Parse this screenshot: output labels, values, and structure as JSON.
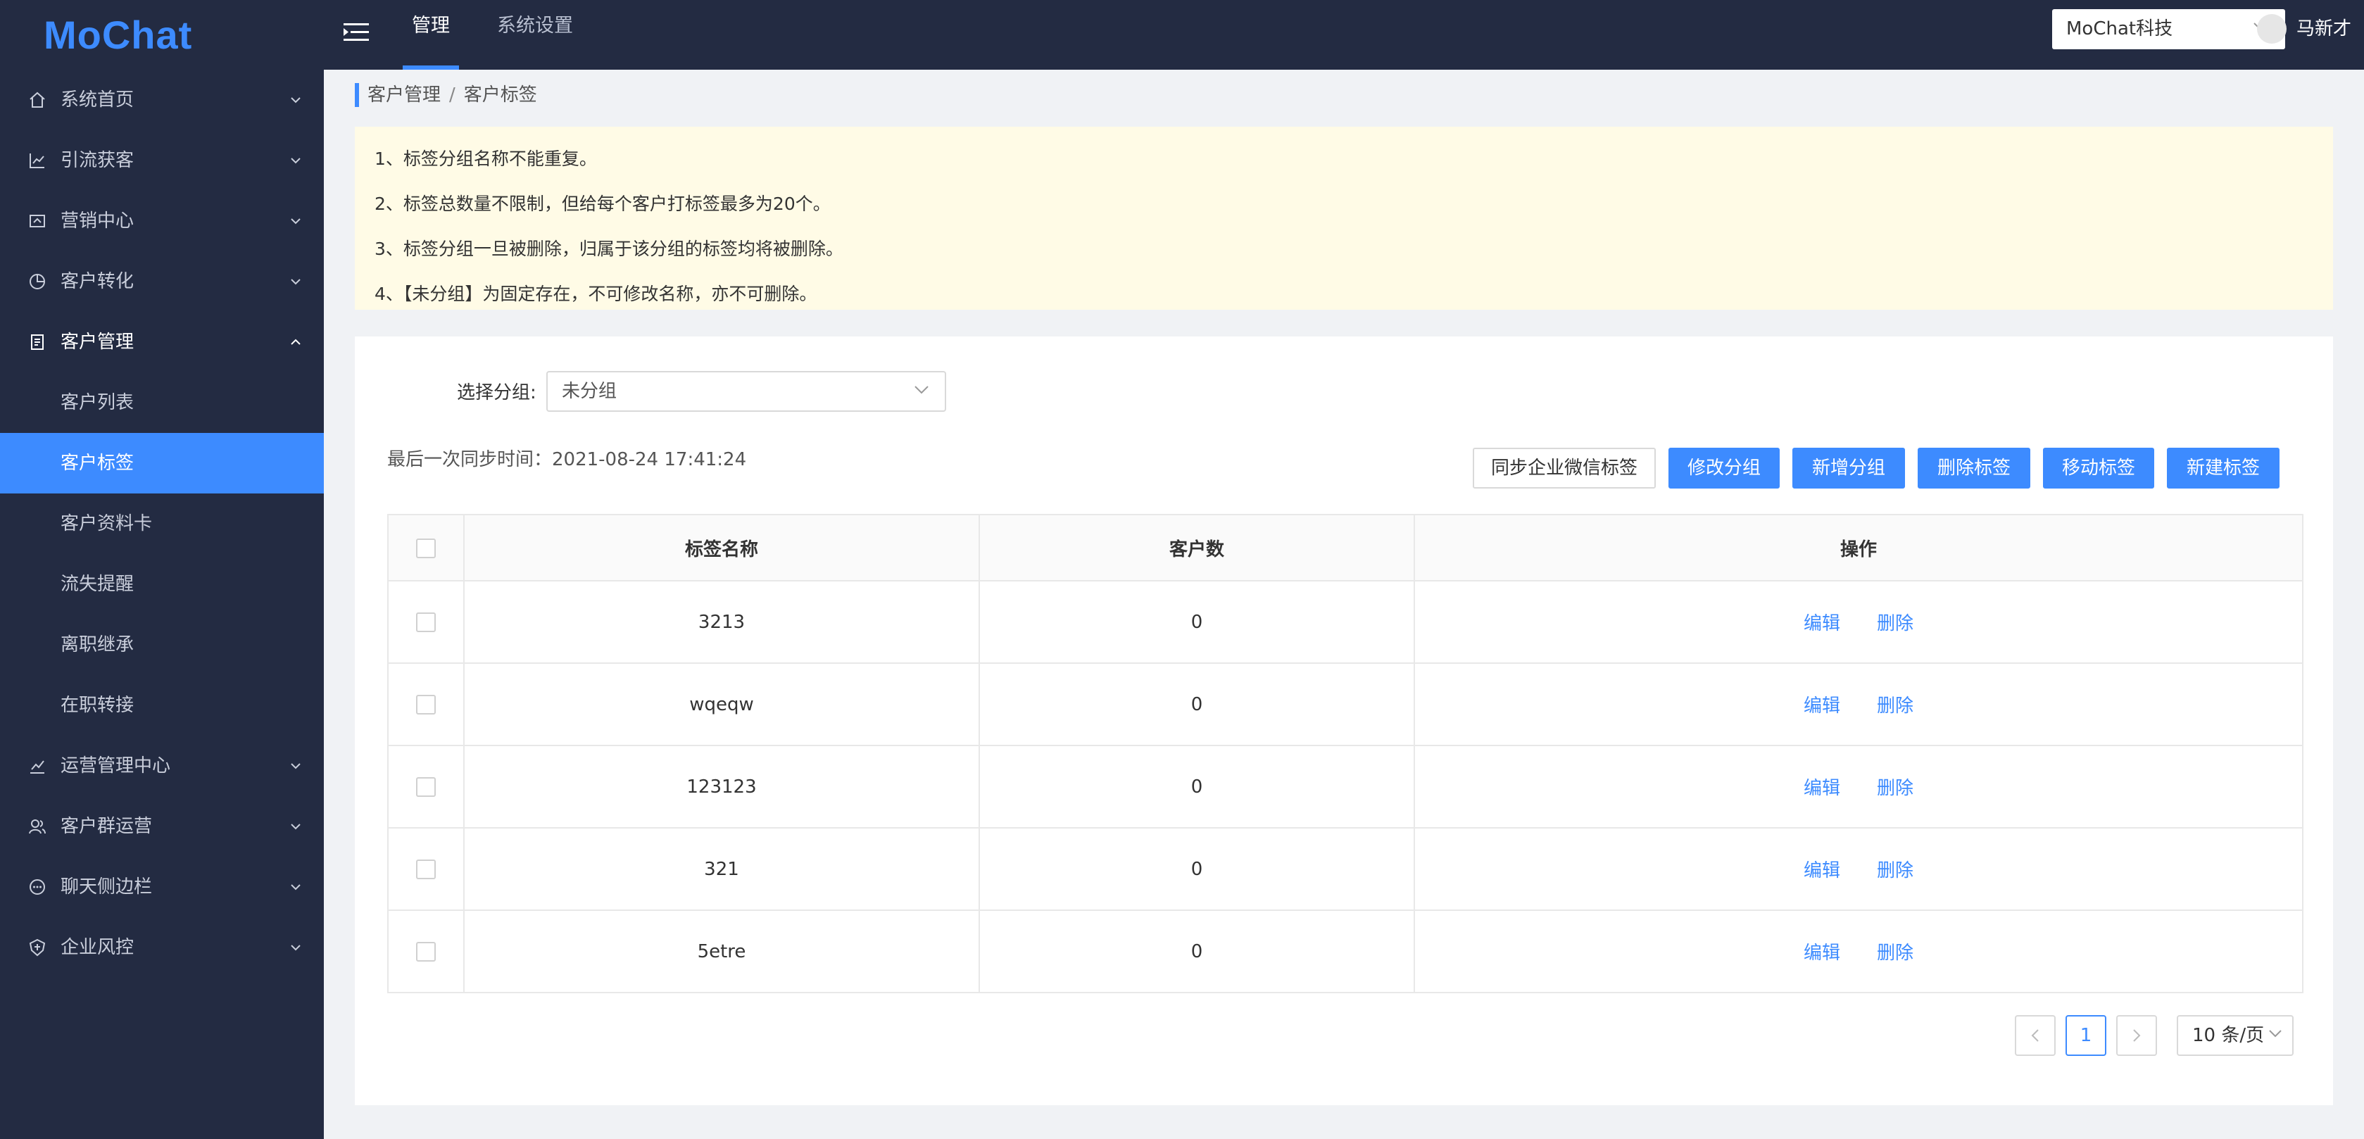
{
  "app": {
    "logo": "MoChat"
  },
  "topbar": {
    "tabs": [
      {
        "label": "管理",
        "active": true
      },
      {
        "label": "系统设置",
        "active": false
      }
    ],
    "corp_select": "MoChat科技",
    "username": "马新才"
  },
  "sidebar": {
    "items": [
      {
        "label": "系统首页",
        "icon": "home-icon"
      },
      {
        "label": "引流获客",
        "icon": "chart-line-icon"
      },
      {
        "label": "营销中心",
        "icon": "megaphone-icon"
      },
      {
        "label": "客户转化",
        "icon": "pie-chart-icon"
      },
      {
        "label": "客户管理",
        "icon": "clipboard-icon",
        "open": true
      },
      {
        "label": "运营管理中心",
        "icon": "trend-icon"
      },
      {
        "label": "客户群运营",
        "icon": "group-icon"
      },
      {
        "label": "聊天侧边栏",
        "icon": "chat-icon"
      },
      {
        "label": "企业风控",
        "icon": "shield-icon"
      }
    ],
    "sub_items": [
      {
        "label": "客户列表"
      },
      {
        "label": "客户标签",
        "active": true
      },
      {
        "label": "客户资料卡"
      },
      {
        "label": "流失提醒"
      },
      {
        "label": "离职继承"
      },
      {
        "label": "在职转接"
      }
    ]
  },
  "breadcrumb": {
    "parent": "客户管理",
    "separator": "/",
    "current": "客户标签"
  },
  "notice": [
    "1、标签分组名称不能重复。",
    "2、标签总数量不限制，但给每个客户打标签最多为20个。",
    "3、标签分组一旦被删除，归属于该分组的标签均将被删除。",
    "4、【未分组】为固定存在，不可修改名称，亦不可删除。"
  ],
  "filter": {
    "label": "选择分组:",
    "value": "未分组"
  },
  "sync": {
    "text": "最后一次同步时间：2021-08-24 17:41:24"
  },
  "toolbar": {
    "sync_wechat": "同步企业微信标签",
    "edit_group": "修改分组",
    "add_group": "新增分组",
    "delete_tags": "删除标签",
    "move_tags": "移动标签",
    "new_tag": "新建标签"
  },
  "table": {
    "columns": [
      "标签名称",
      "客户数",
      "操作"
    ],
    "rows": [
      {
        "name": "3213",
        "count": "0"
      },
      {
        "name": "wqeqw",
        "count": "0"
      },
      {
        "name": "123123",
        "count": "0"
      },
      {
        "name": "321",
        "count": "0"
      },
      {
        "name": "5etre",
        "count": "0"
      }
    ],
    "actions": {
      "edit": "编辑",
      "delete": "删除"
    }
  },
  "pagination": {
    "prev": "<",
    "current_page": "1",
    "next": ">",
    "page_size": "10 条/页"
  },
  "colors": {
    "accent": "#3d8bff",
    "nav_bg": "#232b42",
    "notice_bg": "#fffbe6"
  }
}
